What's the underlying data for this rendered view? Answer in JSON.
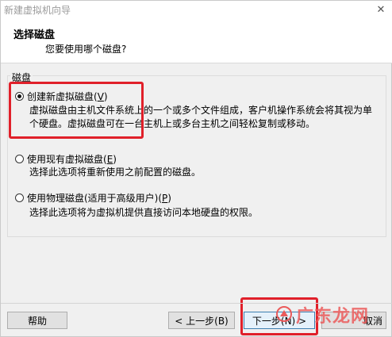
{
  "window": {
    "title": "新建虚拟机向导",
    "close_glyph": "✕"
  },
  "header": {
    "title": "选择磁盘",
    "subtitle": "您要使用哪个磁盘?"
  },
  "group": {
    "label": "磁盘"
  },
  "options": [
    {
      "label_text": "创建新虚拟磁盘(",
      "mnemonic": "V",
      "label_end": ")",
      "selected": true,
      "description_line1": "虚拟磁盘由主机文件系统上的一个或多个文件组成，客户机操作系统会将其视为单",
      "description_line2": "个硬盘。虚拟磁盘可在一台主机上或多台主机之间轻松复制或移动。"
    },
    {
      "label_text": "使用现有虚拟磁盘(",
      "mnemonic": "E",
      "label_end": ")",
      "selected": false,
      "description_line1": "选择此选项将重新使用之前配置的磁盘。"
    },
    {
      "label_text": "使用物理磁盘(适用于高级用户)(",
      "mnemonic": "P",
      "label_end": ")",
      "selected": false,
      "description_line1": "选择此选项将为虚拟机提供直接访问本地硬盘的权限。"
    }
  ],
  "buttons": {
    "help": "帮助",
    "back": "< 上一步(B)",
    "next_visible": "下一步(N) >",
    "cancel_partial": "取消"
  },
  "watermark": {
    "text": "广东龙网"
  },
  "colors": {
    "highlight": "#e0202a",
    "watermark": "#eb5a5a"
  }
}
